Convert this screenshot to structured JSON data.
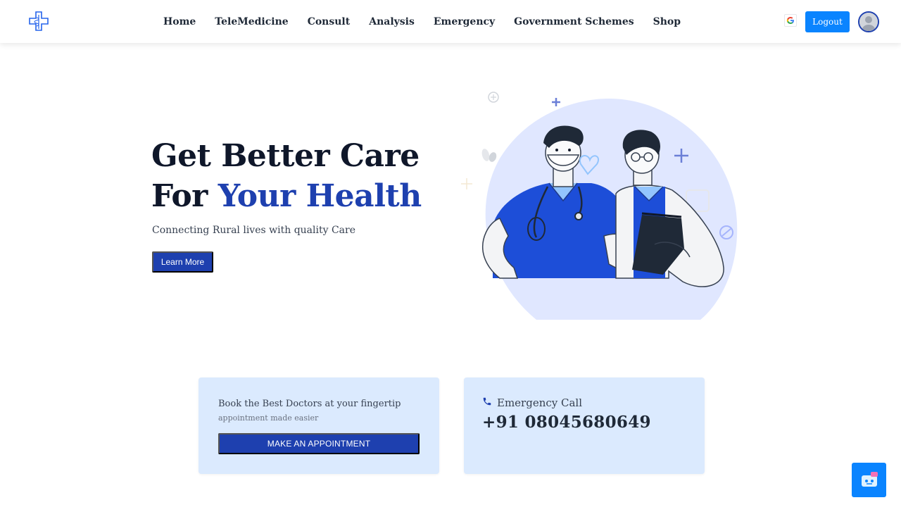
{
  "nav": {
    "logo_icon": "medical-cross-icon",
    "links": [
      "Home",
      "TeleMedicine",
      "Consult",
      "Analysis",
      "Emergency",
      "Government Schemes",
      "Shop"
    ],
    "google_icon": "google-icon",
    "logout_label": "Logout",
    "avatar_icon": "user-avatar-icon"
  },
  "hero": {
    "title_line1": "Get Better Care",
    "title_line2_prefix": "For ",
    "title_line2_accent": "Your Health",
    "subtitle": "Connecting Rural lives with quality Care",
    "learn_more_label": "Learn More"
  },
  "appointment_card": {
    "title": "Book the Best Doctors at your fingertip",
    "subtitle": "appointment made easier",
    "button_label": "MAKE AN APPOINTMENT"
  },
  "emergency_card": {
    "icon": "phone-icon",
    "label": "Emergency Call",
    "number": "+91 08045680649"
  },
  "chat_widget": {
    "icon": "chatbot-icon"
  },
  "colors": {
    "accent": "#1e40af",
    "primary_button": "#0a84ff",
    "card_bg": "#dbeafe",
    "dark_text": "#0f172a"
  }
}
